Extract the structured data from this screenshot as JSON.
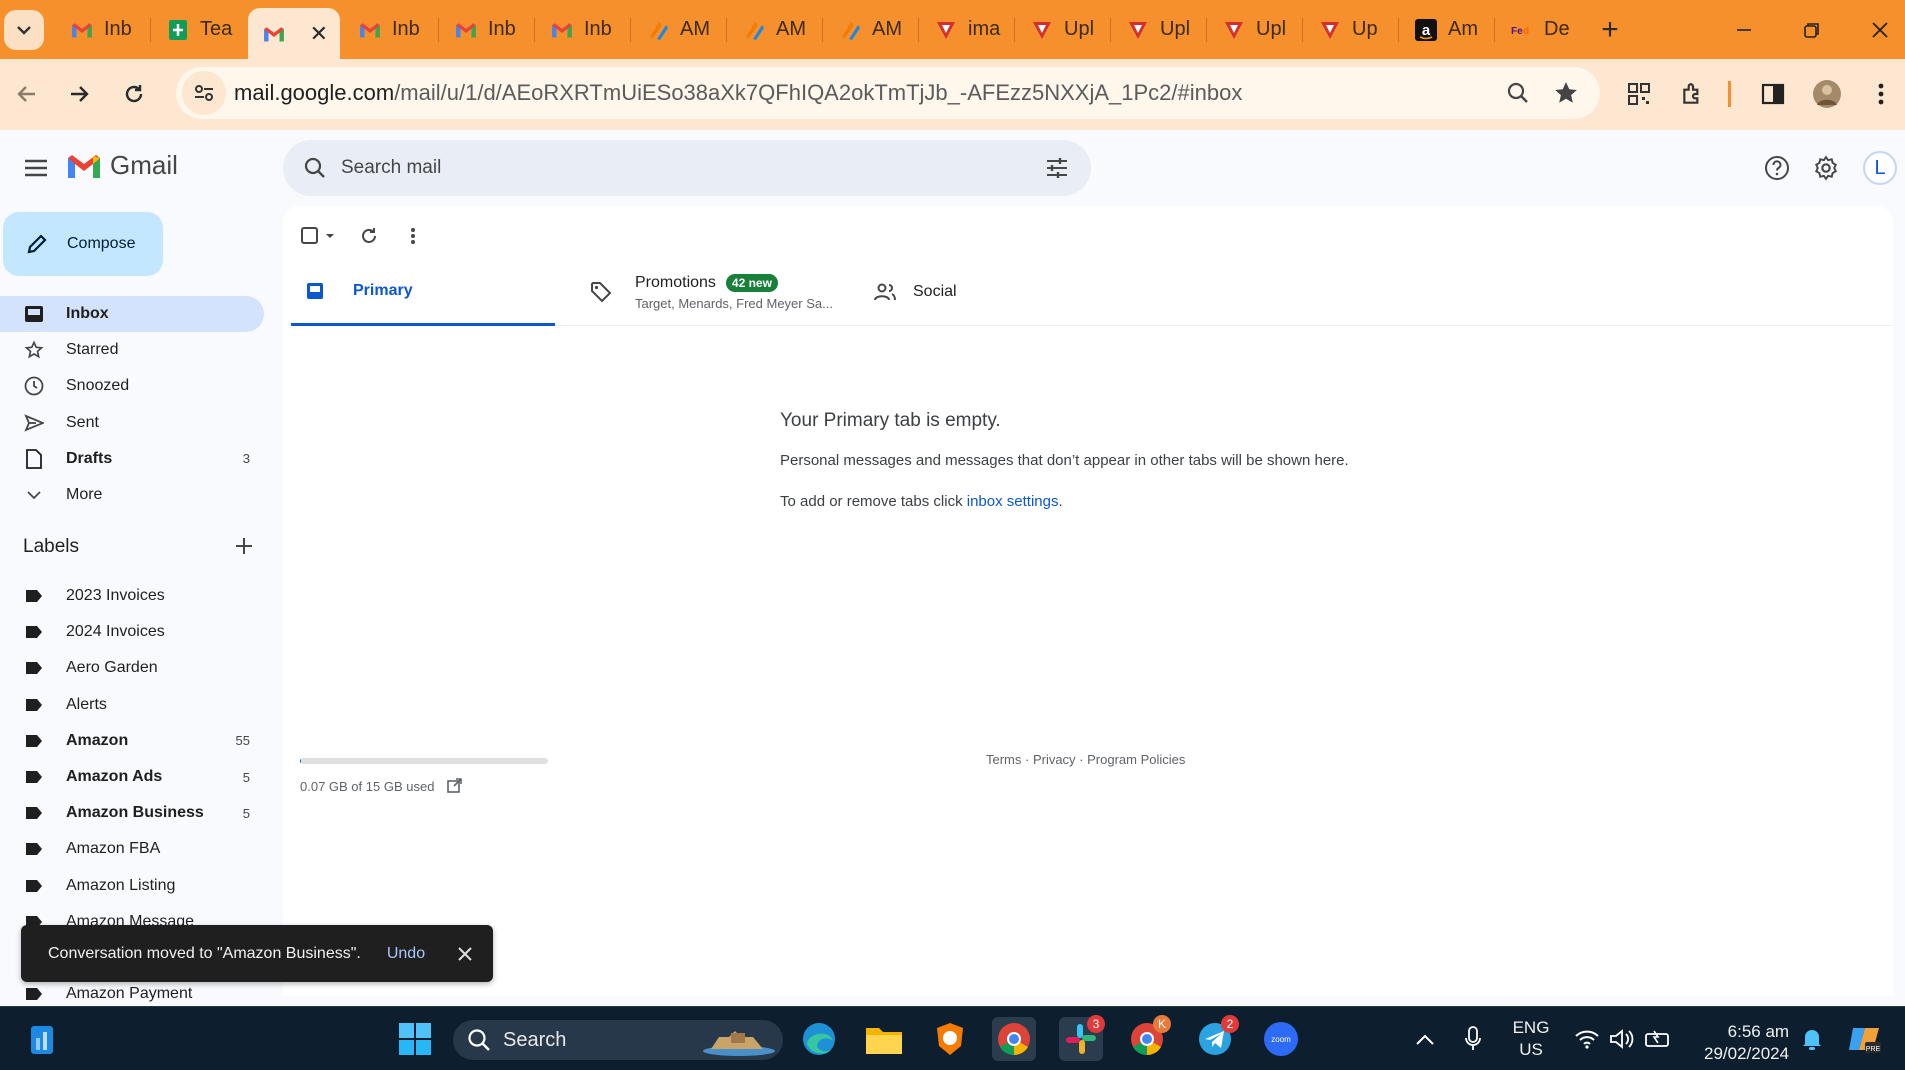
{
  "browser": {
    "tabs": [
      {
        "label": "Inb",
        "icon": "gmail-icon"
      },
      {
        "label": "Tea",
        "icon": "sheets-icon"
      },
      {
        "label": "",
        "icon": "gmail-icon",
        "active": true
      },
      {
        "label": "Inb",
        "icon": "gmail-icon"
      },
      {
        "label": "Inb",
        "icon": "gmail-icon"
      },
      {
        "label": "Inb",
        "icon": "gmail-icon"
      },
      {
        "label": "AM",
        "icon": "am-icon"
      },
      {
        "label": "AM",
        "icon": "am-icon"
      },
      {
        "label": "AM",
        "icon": "am-icon"
      },
      {
        "label": "ima",
        "icon": "red-shield-icon"
      },
      {
        "label": "Upl",
        "icon": "red-shield-icon"
      },
      {
        "label": "Upl",
        "icon": "red-shield-icon"
      },
      {
        "label": "Upl",
        "icon": "red-shield-icon"
      },
      {
        "label": "Up",
        "icon": "red-shield-icon"
      },
      {
        "label": "Am",
        "icon": "amazon-icon"
      },
      {
        "label": "De",
        "icon": "fedex-icon"
      }
    ],
    "url_host": "mail.google.com",
    "url_path": "/mail/u/1/d/AEoRXRTmUiESo38aXk7QFhIQA2okTmTjJb_-AFEzz5NXXjA_1Pc2/#inbox"
  },
  "gmail": {
    "logo_text": "Gmail",
    "search_placeholder": "Search mail",
    "compose_label": "Compose",
    "avatar_letter": "L",
    "nav": [
      {
        "label": "Inbox",
        "icon": "inbox-icon",
        "count": "",
        "active": true,
        "bold": true
      },
      {
        "label": "Starred",
        "icon": "star-icon",
        "count": ""
      },
      {
        "label": "Snoozed",
        "icon": "clock-icon",
        "count": ""
      },
      {
        "label": "Sent",
        "icon": "send-icon",
        "count": ""
      },
      {
        "label": "Drafts",
        "icon": "draft-icon",
        "count": "3",
        "bold": true
      },
      {
        "label": "More",
        "icon": "chevron-down-icon",
        "count": ""
      }
    ],
    "labels_heading": "Labels",
    "labels": [
      {
        "label": "2023 Invoices",
        "count": ""
      },
      {
        "label": "2024 Invoices",
        "count": ""
      },
      {
        "label": "Aero Garden",
        "count": ""
      },
      {
        "label": "Alerts",
        "count": ""
      },
      {
        "label": "Amazon",
        "count": "55",
        "bold": true
      },
      {
        "label": "Amazon Ads",
        "count": "5",
        "bold": true
      },
      {
        "label": "Amazon Business",
        "count": "5",
        "bold": true
      },
      {
        "label": "Amazon FBA",
        "count": ""
      },
      {
        "label": "Amazon Listing",
        "count": ""
      },
      {
        "label": "Amazon Message",
        "count": ""
      },
      {
        "label": "",
        "count": ""
      },
      {
        "label": "Amazon Payment",
        "count": ""
      }
    ],
    "tabs": {
      "primary": "Primary",
      "promotions": "Promotions",
      "promotions_badge": "42 new",
      "promotions_snippet": "Target, Menards, Fred Meyer Sa...",
      "social": "Social"
    },
    "empty": {
      "title": "Your Primary tab is empty.",
      "line1": "Personal messages and messages that don’t appear in other tabs will be shown here.",
      "line2_prefix": "To add or remove tabs click ",
      "line2_link": "inbox settings",
      "line2_suffix": "."
    },
    "storage_text": "0.07 GB of 15 GB used",
    "storage_fraction": 0.005,
    "footer": "Terms · Privacy · Program Policies",
    "snackbar": {
      "message": "Conversation moved to \"Amazon Business\".",
      "undo": "Undo"
    }
  },
  "taskbar": {
    "search_label": "Search",
    "slack_badge": "3",
    "telegram_badge": "2",
    "chrome_k_badge": "K",
    "lang_line1": "ENG",
    "lang_line2": "US",
    "time": "6:56 am",
    "date": "29/02/2024"
  },
  "colors": {
    "tabstrip": "#f5902d",
    "toolbar": "#fde7d0",
    "compose": "#c2e7ff",
    "nav_active": "#d3e3fd",
    "primary_blue": "#0b57d0",
    "badge_green": "#188038",
    "taskbar": "#0d1f2e"
  }
}
